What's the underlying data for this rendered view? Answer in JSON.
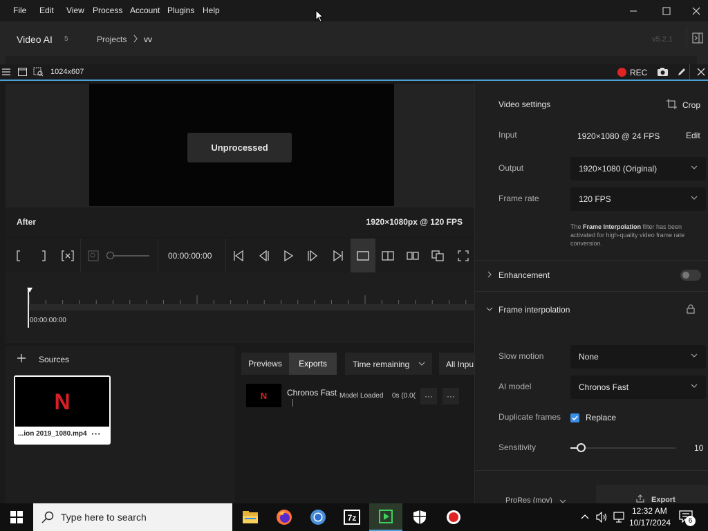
{
  "menubar": {
    "items": [
      "File",
      "Edit",
      "View",
      "Process",
      "Account",
      "Plugins",
      "Help"
    ]
  },
  "header": {
    "app_name": "Video AI",
    "badge": "5",
    "breadcrumb_root": "Projects",
    "breadcrumb_current": "vv",
    "version": "v5.2.1"
  },
  "recorder": {
    "resolution": "1024x607",
    "rec_label": "REC",
    "rec_color": "#e02424"
  },
  "preview": {
    "overlay_label": "Unprocessed",
    "side_label": "After",
    "resolution_info": "1920×1080px @ 120 FPS"
  },
  "playback": {
    "timecode": "00:00:00:00"
  },
  "timeline": {
    "timecode": "00:00:00:00"
  },
  "sources": {
    "title": "Sources",
    "file_name": "...ion 2019_1080.mp4",
    "thumb_letter": "N"
  },
  "queue": {
    "tab_previews": "Previews",
    "tab_exports": "Exports",
    "sort_label": "Time remaining",
    "filter_label": "All Inpu",
    "item_name": "Chronos Fast",
    "item_status": "Model Loaded",
    "item_time": "0s (0.0(",
    "thumb_letter": "N"
  },
  "settings": {
    "section_title": "Video settings",
    "crop_label": "Crop",
    "input_label": "Input",
    "input_value": "1920×1080 @ 24 FPS",
    "edit_label": "Edit",
    "output_label": "Output",
    "output_value": "1920×1080 (Original)",
    "framerate_label": "Frame rate",
    "framerate_value": "120 FPS",
    "note_pre": "The ",
    "note_bold": "Frame Interpolation",
    "note_post": " filter has been activated for high-quality video frame rate conversion.",
    "enhancement_label": "Enhancement",
    "enhancement_enabled": false,
    "interp_label": "Frame interpolation",
    "slowmo_label": "Slow motion",
    "slowmo_value": "None",
    "aimodel_label": "AI model",
    "aimodel_value": "Chronos Fast",
    "duplicate_label": "Duplicate frames",
    "replace_label": "Replace",
    "replace_checked": true,
    "sensitivity_label": "Sensitivity",
    "sensitivity_value": "10",
    "format_label": "ProRes (mov)",
    "export_label": "Export",
    "accent": "#3a8ee6"
  },
  "taskbar": {
    "search_placeholder": "Type here to search",
    "time": "12:32 AM",
    "date": "10/17/2024",
    "notification_count": "6"
  }
}
